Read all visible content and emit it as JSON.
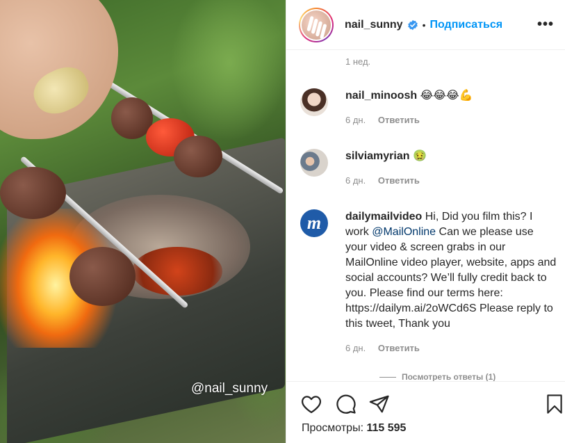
{
  "post": {
    "author": "nail_sunny",
    "separator": "•",
    "follow_label": "Подписаться",
    "more_label": "•••",
    "watermark": "@nail_sunny",
    "views_label": "Просмотры:",
    "views_count": "115 595"
  },
  "comments": {
    "top_time": "1 нед.",
    "items": [
      {
        "user": "nail_minoosh",
        "text": "😂😂😂💪",
        "time": "6 дн.",
        "reply": "Ответить"
      },
      {
        "user": "silviamyrian",
        "text": "🤢",
        "time": "6 дн.",
        "reply": "Ответить"
      },
      {
        "user": "dailymailvideo",
        "text_before": "Hi, Did you film this? I work ",
        "mention": "@MailOnline",
        "text_after": " Can we please use your video & screen grabs in our MailOnline video player, website, apps and social accounts? We’ll fully credit back to you. Please find our terms here: https://dailym.ai/2oWCd6S Please reply to this tweet, Thank you",
        "time": "6 дн.",
        "reply": "Ответить"
      }
    ],
    "view_replies": "Посмотреть ответы (1)"
  },
  "colors": {
    "accent": "#0095f6",
    "verified": "#3897f0",
    "muted": "#8e8e8e",
    "text": "#262626"
  },
  "icons": [
    "heart-icon",
    "comment-icon",
    "share-icon",
    "bookmark-icon",
    "verified-badge-icon"
  ]
}
